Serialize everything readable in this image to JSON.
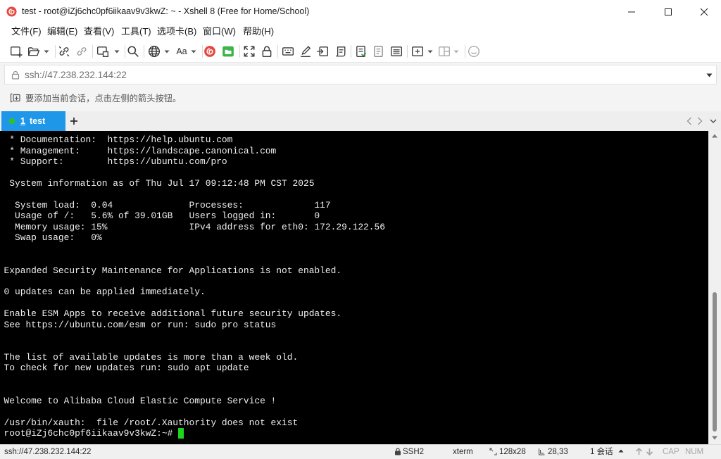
{
  "window": {
    "title": "test - root@iZj6chc0pf6iikaav9v3kwZ: ~ - Xshell 8 (Free for Home/School)",
    "app_icon": "xshell-logo-icon",
    "controls": [
      "minimize-icon",
      "maximize-icon",
      "close-icon"
    ]
  },
  "menu": {
    "items": [
      "文件(F)",
      "编辑(E)",
      "查看(V)",
      "工具(T)",
      "选项卡(B)",
      "窗口(W)",
      "帮助(H)"
    ]
  },
  "toolbar": {
    "font_label": "Aa",
    "icons": [
      "new-session-icon",
      "open-session-icon",
      "reconnect-icon",
      "disconnect-icon",
      "new-window-icon",
      "find-icon",
      "encoding-globe-icon",
      "font-icon",
      "xshell-icon",
      "xftp-icon",
      "fullscreen-icon",
      "lock-icon",
      "keyboard-icon",
      "highlight-icon",
      "send-key-icon",
      "script-icon",
      "compose-bar-icon",
      "compose-pane-icon",
      "quick-commands-icon",
      "new-tab-icon",
      "layout-icon",
      "chat-icon"
    ]
  },
  "address": {
    "value": "ssh://47.238.232.144:22",
    "icons": [
      "lock-icon",
      "dropdown-icon"
    ]
  },
  "hint": {
    "text": "要添加当前会话，点击左侧的箭头按钮。",
    "icon": "add-session-icon"
  },
  "tabs": [
    {
      "number": "1",
      "name": "test",
      "status_icon": "connected-dot-icon"
    }
  ],
  "tab_nav_icons": [
    "add-tab-icon",
    "chevron-left-icon",
    "chevron-right-icon",
    "tab-menu-icon"
  ],
  "terminal": {
    "lines": [
      " * Documentation:  https://help.ubuntu.com",
      " * Management:     https://landscape.canonical.com",
      " * Support:        https://ubuntu.com/pro",
      "",
      " System information as of Thu Jul 17 09:12:48 PM CST 2025",
      "",
      "  System load:  0.04              Processes:             117",
      "  Usage of /:   5.6% of 39.01GB   Users logged in:       0",
      "  Memory usage: 15%               IPv4 address for eth0: 172.29.122.56",
      "  Swap usage:   0%",
      "",
      "",
      "Expanded Security Maintenance for Applications is not enabled.",
      "",
      "0 updates can be applied immediately.",
      "",
      "Enable ESM Apps to receive additional future security updates.",
      "See https://ubuntu.com/esm or run: sudo pro status",
      "",
      "",
      "The list of available updates is more than a week old.",
      "To check for new updates run: sudo apt update",
      "",
      "",
      "Welcome to Alibaba Cloud Elastic Compute Service !",
      "",
      "/usr/bin/xauth:  file /root/.Xauthority does not exist"
    ],
    "prompt": "root@iZj6chc0pf6iikaav9v3kwZ:~# "
  },
  "status": {
    "address": "ssh://47.238.232.144:22",
    "protocol": "SSH2",
    "term_type": "xterm",
    "size": "128x28",
    "cursor_pos": "28,33",
    "sessions": "1 会话",
    "cap": "CAP",
    "num": "NUM"
  },
  "colors": {
    "terminal_bg": "#000000",
    "terminal_fg": "#f0f0f0",
    "cursor": "#1ed21e",
    "active_tab": "#1f97e8",
    "connected_dot": "#2ec12e",
    "xshell_red": "#e5483f",
    "xftp_green": "#3bb54a"
  }
}
